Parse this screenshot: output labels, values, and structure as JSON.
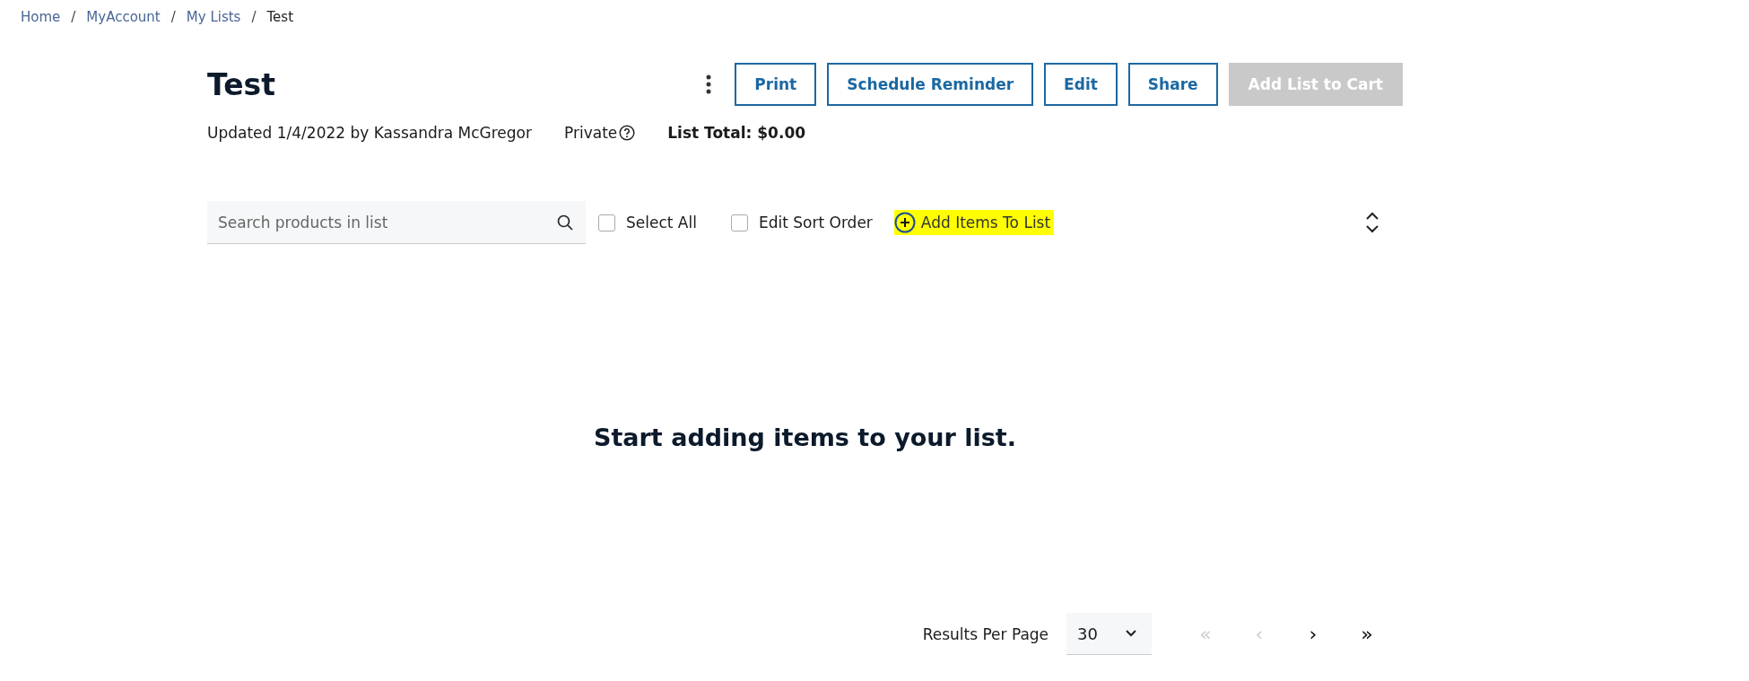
{
  "breadcrumb_separator": "/",
  "breadcrumb": [
    {
      "label": "Home",
      "current": false
    },
    {
      "label": "MyAccount",
      "current": false
    },
    {
      "label": "My Lists",
      "current": false
    },
    {
      "label": "Test",
      "current": true
    }
  ],
  "title": "Test",
  "actions": [
    {
      "label": "Print",
      "disabled": false
    },
    {
      "label": "Schedule Reminder",
      "disabled": false
    },
    {
      "label": "Edit",
      "disabled": false
    },
    {
      "label": "Share",
      "disabled": false
    },
    {
      "label": "Add List to Cart",
      "disabled": true
    }
  ],
  "meta": {
    "updated": "Updated 1/4/2022 by Kassandra McGregor",
    "visibility": "Private",
    "total": "List Total: $0.00"
  },
  "toolbar": {
    "search": {
      "placeholder": "Search products in list"
    },
    "checkboxes": [
      {
        "label": "Select All",
        "checked": false
      },
      {
        "label": "Edit Sort Order",
        "checked": false
      }
    ],
    "add_items": {
      "label": "Add Items To List",
      "highlighted": true
    }
  },
  "empty_message": "Start adding items to your list.",
  "pagination": {
    "label": "Results Per Page",
    "per_page": "30",
    "buttons": [
      {
        "symbol": "«",
        "disabled": true
      },
      {
        "symbol": "‹",
        "disabled": true
      },
      {
        "symbol": "›",
        "disabled": false
      },
      {
        "symbol": "»",
        "disabled": false
      }
    ]
  }
}
